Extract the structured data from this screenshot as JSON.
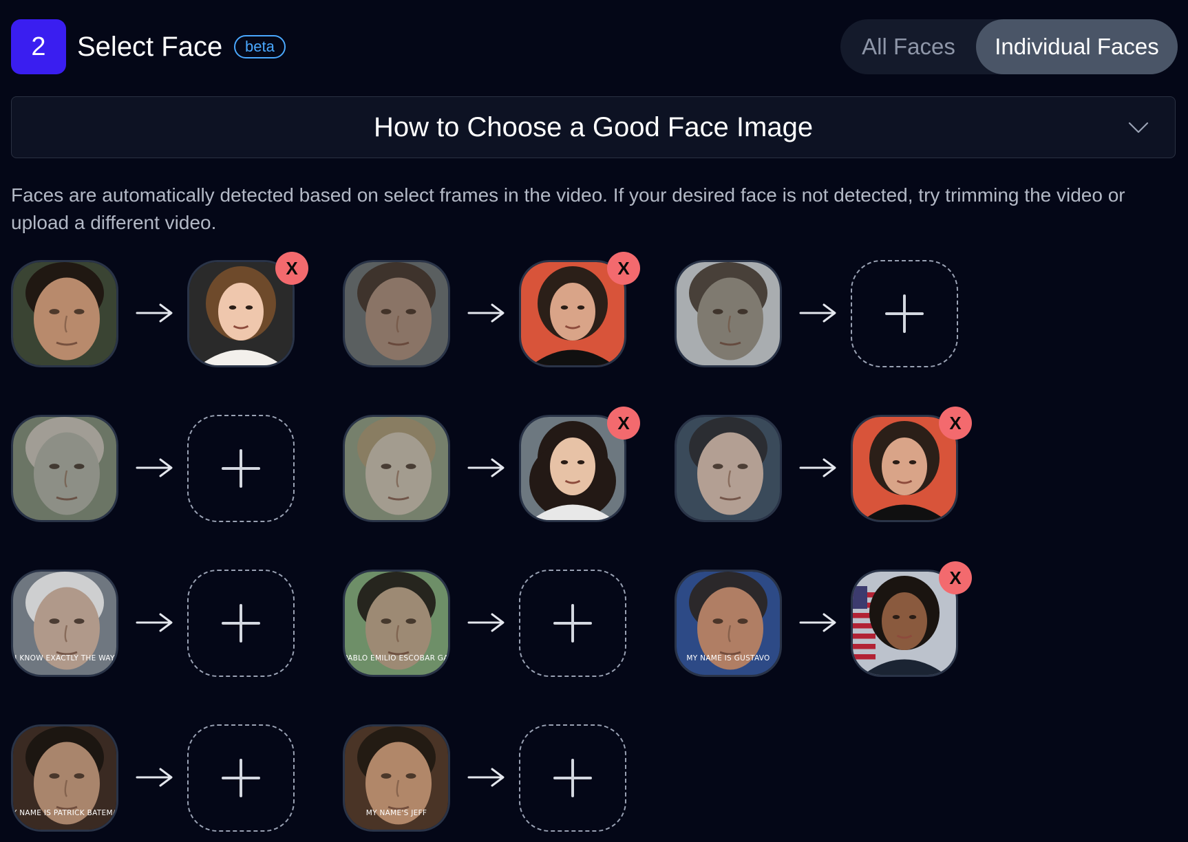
{
  "header": {
    "step_number": "2",
    "title": "Select Face",
    "beta_label": "beta",
    "toggle": {
      "all_label": "All Faces",
      "individual_label": "Individual Faces",
      "selected": "Individual Faces"
    }
  },
  "accordion": {
    "title": "How to Choose a Good Face Image",
    "expanded": false
  },
  "description": "Faces are automatically detected based on select frames in the video. If your desired face is not detected, try trimming the video or upload a different video.",
  "remove_label": "X",
  "colors": {
    "background": "#040717",
    "step_badge": "#3a1ef0",
    "beta": "#4aa8ff",
    "remove": "#f36a6e",
    "toggle_active": "#4a5567"
  },
  "face_rows": [
    [
      {
        "source": "detected-face-1",
        "target": "replacement-face-woman-brown-hair"
      },
      {
        "source": "detected-face-2",
        "target": "replacement-face-man-red-background"
      },
      {
        "source": "detected-face-3",
        "target": null
      }
    ],
    [
      {
        "source": "detected-face-4",
        "target": null
      },
      {
        "source": "detected-face-5",
        "target": "replacement-face-woman-curly-hair"
      },
      {
        "source": "detected-face-6",
        "target": "replacement-face-man-red-background"
      }
    ],
    [
      {
        "source": "detected-face-7",
        "source_caption": "I KNOW EXACTLY THE WAY",
        "target": null
      },
      {
        "source": "detected-face-8",
        "source_caption": "I AM PABLO EMILIO ESCOBAR GAVIRIA",
        "target": null
      },
      {
        "source": "detected-face-9",
        "source_caption": "MY NAME IS GUSTAVO",
        "target": "replacement-face-man-flag-background"
      }
    ],
    [
      {
        "source": "detected-face-10",
        "source_caption": "MY NAME IS PATRICK BATEMAN",
        "target": null
      },
      {
        "source": "detected-face-11",
        "source_caption": "MY NAME'S JEFF",
        "target": null
      }
    ]
  ]
}
